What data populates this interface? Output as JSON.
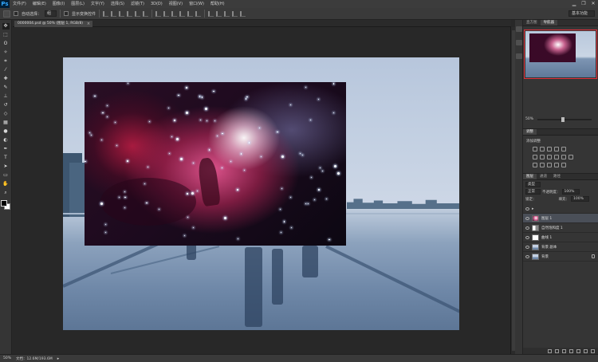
{
  "app": {
    "logo": "Ps",
    "menu": [
      "文件(F)",
      "编辑(E)",
      "图像(I)",
      "图层(L)",
      "文字(Y)",
      "选择(S)",
      "滤镜(T)",
      "3D(D)",
      "视图(V)",
      "窗口(W)",
      "帮助(H)"
    ],
    "window_controls": [
      "minimize",
      "restore",
      "close"
    ],
    "window_control_glyphs": [
      "▁",
      "❐",
      "✕"
    ]
  },
  "options": {
    "auto_select_label": "自动选择：",
    "auto_select_value": "组",
    "show_transform_label": "显示变换控件",
    "workspace": "基本功能"
  },
  "document": {
    "tab_title": "0000004.psd @ 50% (图层 1, RGB/8)",
    "close_glyph": "×"
  },
  "tools": [
    "move-tool",
    "marquee-tool",
    "lasso-tool",
    "magic-wand-tool",
    "crop-tool",
    "eyedropper-tool",
    "healing-tool",
    "brush-tool",
    "stamp-tool",
    "history-brush-tool",
    "eraser-tool",
    "gradient-tool",
    "blur-tool",
    "dodge-tool",
    "pen-tool",
    "type-tool",
    "path-select-tool",
    "shape-tool",
    "hand-tool",
    "zoom-tool"
  ],
  "tool_glyphs": [
    "✥",
    "⬚",
    "ʘ",
    "✧",
    "⌗",
    "⁄",
    "✚",
    "✎",
    "⊥",
    "↺",
    "◇",
    "▦",
    "●",
    "◐",
    "✒",
    "T",
    "➤",
    "▭",
    "✋",
    "⌕"
  ],
  "panels": {
    "navigator_tabs": [
      "直方图",
      "导航器"
    ],
    "navigator_active": 1,
    "zoom": "50%",
    "adjustments_tabs": [
      "调整"
    ],
    "adjustments_title": "添加调整",
    "layers_tabs": [
      "图层",
      "通道",
      "路径"
    ],
    "layers_active": 0,
    "kind_label": "类型",
    "blend_mode": "正常",
    "opacity_label": "不透明度：",
    "opacity": "100%",
    "lock_label": "锁定：",
    "fill_label": "填充：",
    "fill": "100%",
    "layers": [
      {
        "name": "图层 1",
        "selected": true,
        "thumb": "nebula"
      },
      {
        "name": "自然饱和度 1",
        "selected": false,
        "thumb": "adjustment"
      },
      {
        "name": "曲线 1",
        "selected": false,
        "thumb": "white"
      },
      {
        "name": "背景 副本",
        "selected": false,
        "thumb": "photo"
      },
      {
        "name": "背景",
        "selected": false,
        "thumb": "photo",
        "locked": true
      }
    ]
  },
  "status": {
    "zoom": "50%",
    "doc_info": "文档：12.6M/193.6M",
    "arrow": "▸"
  },
  "colors": {
    "foreground": "#000000",
    "background": "#ffffff",
    "nav_highlight": "#e0303a",
    "accent": "#31a8ff"
  }
}
